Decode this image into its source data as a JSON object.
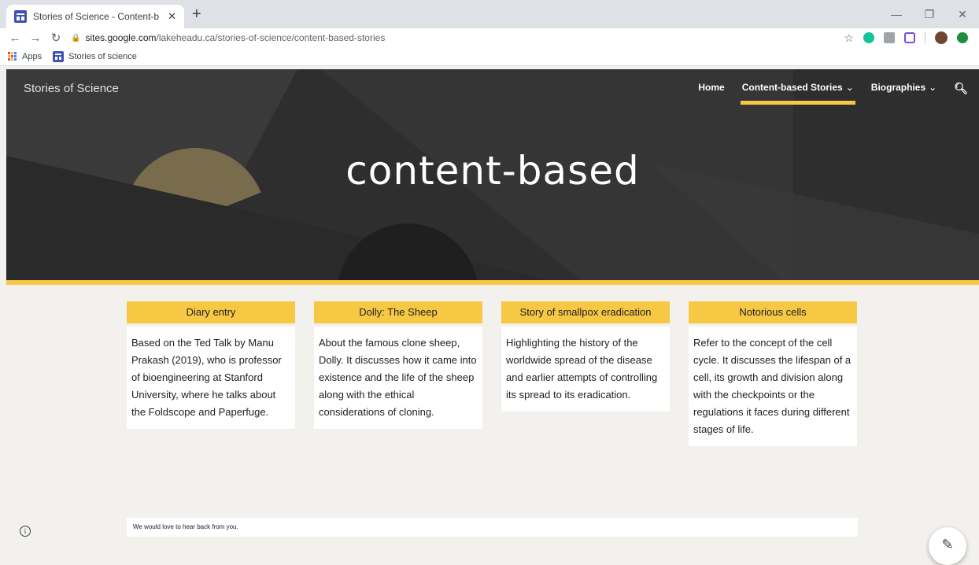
{
  "browser": {
    "tab_title": "Stories of Science - Content-bas",
    "tab_close": "✕",
    "new_tab": "+",
    "url_host": "sites.google.com",
    "url_path": "/lakeheadu.ca/stories-of-science/content-based-stories",
    "bookmarks": [
      {
        "label": "Apps"
      },
      {
        "label": "Stories of science"
      }
    ]
  },
  "site": {
    "title": "Stories of Science",
    "nav": [
      {
        "label": "Home"
      },
      {
        "label": "Content-based Stories"
      },
      {
        "label": "Biographies"
      }
    ],
    "hero_title": "content-based"
  },
  "cards": [
    {
      "title": "Diary entry",
      "body": "Based on the Ted Talk by Manu Prakash (2019), who is professor of bioengineering at Stanford University, where he talks about the Foldscope and Paperfuge."
    },
    {
      "title": "Dolly: The Sheep",
      "body": "About the famous clone sheep, Dolly. It discusses how it came into existence and the life of the sheep along with the ethical considerations of cloning."
    },
    {
      "title": "Story of smallpox eradication",
      "body": "Highlighting the history of the worldwide spread of the disease and earlier attempts of controlling its spread to its eradication."
    },
    {
      "title": "Notorious cells",
      "body": "Refer to the concept of the cell cycle. It discusses the lifespan of a cell, its growth and division along with the checkpoints or the regulations it faces during different stages of life."
    }
  ],
  "footer": {
    "message": "We would love to hear back from you."
  },
  "colors": {
    "accent": "#f7c844",
    "hero_bg": "#2e2e2e",
    "page_bg": "#f3f1ee"
  },
  "icons": {
    "info": "info-icon",
    "edit": "pencil-icon",
    "search": "search-icon"
  }
}
